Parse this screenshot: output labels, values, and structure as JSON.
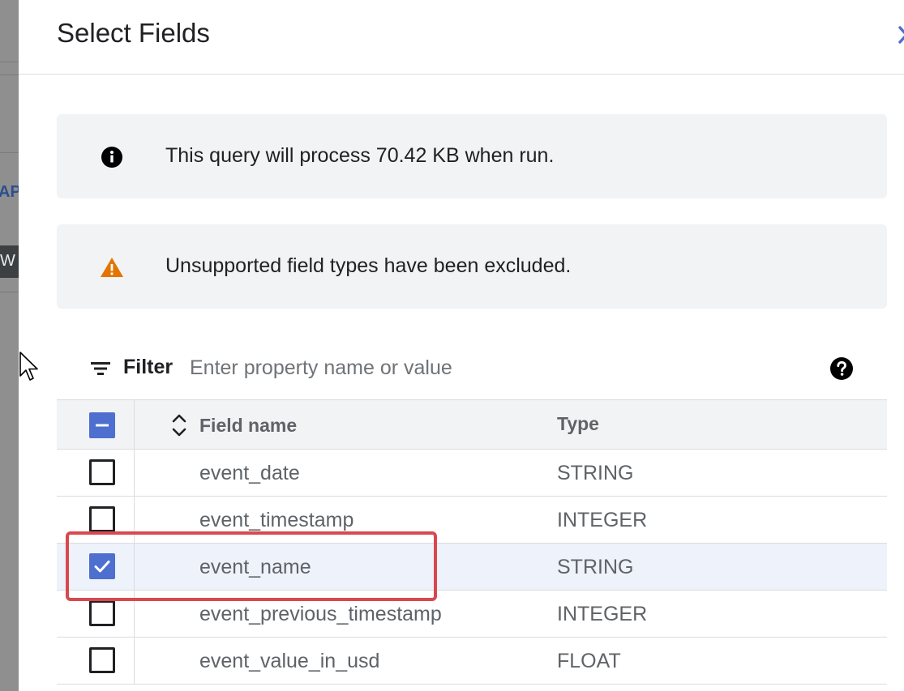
{
  "background": {
    "fragment_top": "APS",
    "fragment_tab": "W"
  },
  "dialog": {
    "title": "Select Fields",
    "close_icon": "close-icon"
  },
  "info_banner": {
    "icon": "info-icon",
    "text": "This query will process 70.42 KB when run."
  },
  "warning_banner": {
    "icon": "warning-icon",
    "text": "Unsupported field types have been excluded."
  },
  "filter": {
    "icon": "filter-icon",
    "label": "Filter",
    "placeholder": "Enter property name or value",
    "value": "",
    "help_icon": "help-icon"
  },
  "table": {
    "header_checkbox_state": "indeterminate",
    "columns": {
      "name": "Field name",
      "type": "Type"
    },
    "rows": [
      {
        "name": "event_date",
        "type": "STRING",
        "checked": false
      },
      {
        "name": "event_timestamp",
        "type": "INTEGER",
        "checked": false
      },
      {
        "name": "event_name",
        "type": "STRING",
        "checked": true
      },
      {
        "name": "event_previous_timestamp",
        "type": "INTEGER",
        "checked": false
      },
      {
        "name": "event_value_in_usd",
        "type": "FLOAT",
        "checked": false
      }
    ]
  },
  "colors": {
    "accent": "#4e6ed0",
    "warning": "#e37400",
    "annotation": "#d9484e",
    "selected_row": "#eef2fb"
  }
}
